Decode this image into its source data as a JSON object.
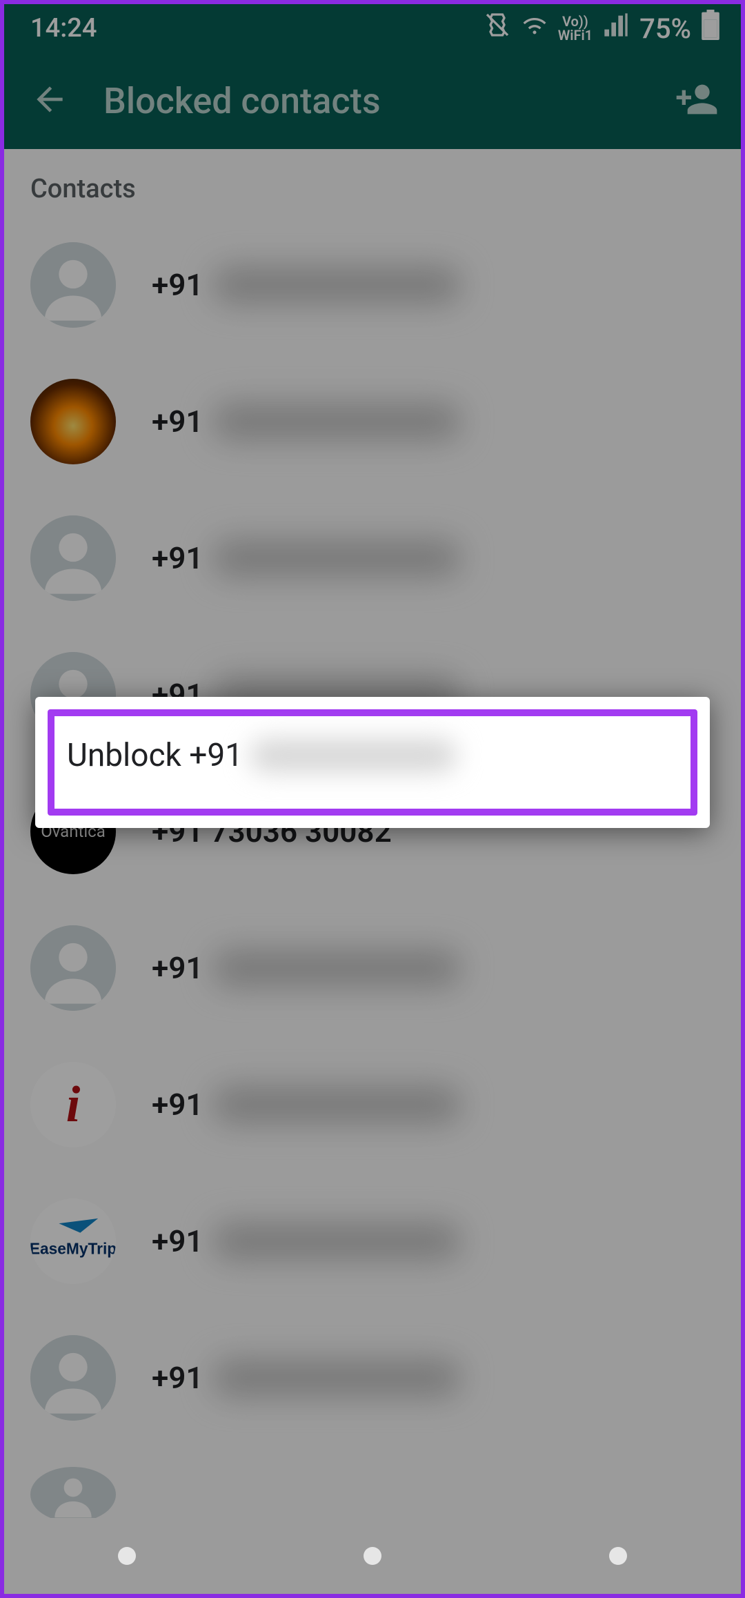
{
  "status": {
    "time": "14:24",
    "wifi_label": "WiFi1",
    "vo_label": "Vo))",
    "battery": "75%"
  },
  "appbar": {
    "title": "Blocked contacts"
  },
  "section": {
    "header": "Contacts"
  },
  "contacts": [
    {
      "prefix": "+91",
      "avatar": "default"
    },
    {
      "prefix": "+91",
      "avatar": "sunset"
    },
    {
      "prefix": "+91",
      "avatar": "default"
    },
    {
      "prefix": "+91",
      "avatar": "default"
    },
    {
      "prefix": "+91 73036 30082",
      "avatar": "ovantica",
      "avatar_label": "Ovantica"
    },
    {
      "prefix": "+91",
      "avatar": "default"
    },
    {
      "prefix": "+91",
      "avatar": "logo_i"
    },
    {
      "prefix": "+91",
      "avatar": "easemytrip",
      "avatar_label": "EaseMyTrip"
    },
    {
      "prefix": "+91",
      "avatar": "default"
    }
  ],
  "popup": {
    "label": "Unblock +91"
  }
}
